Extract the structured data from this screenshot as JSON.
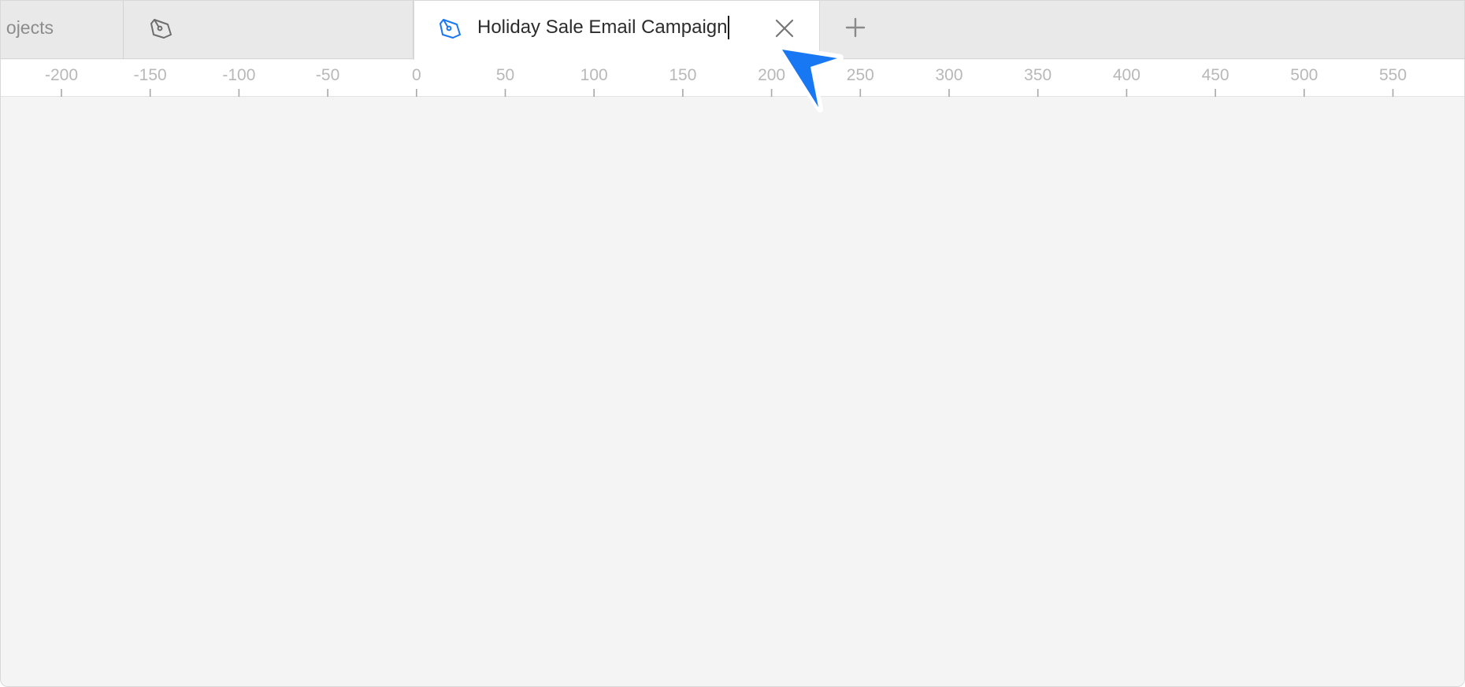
{
  "tabs": [
    {
      "label": "Projects",
      "visible_label": "ojects",
      "icon": "projects-icon"
    },
    {
      "label": "",
      "icon": "pen-tool-icon"
    },
    {
      "label": "Holiday Sale Email Campaign",
      "icon": "pen-tool-icon",
      "active": true
    }
  ],
  "active_tab": {
    "title": "Holiday Sale Email Campaign",
    "close_icon": "close-icon"
  },
  "new_tab_icon": "plus-icon",
  "ruler": {
    "labels": [
      "-200",
      "-150",
      "-100",
      "-50",
      "0",
      "50",
      "100",
      "150",
      "200",
      "250",
      "300",
      "350",
      "400",
      "450",
      "500",
      "550"
    ]
  },
  "colors": {
    "accent": "#1877f2",
    "tabbar_bg": "#e9e9e9",
    "canvas_bg": "#f4f4f4",
    "ruler_text": "#b8b8b8"
  }
}
